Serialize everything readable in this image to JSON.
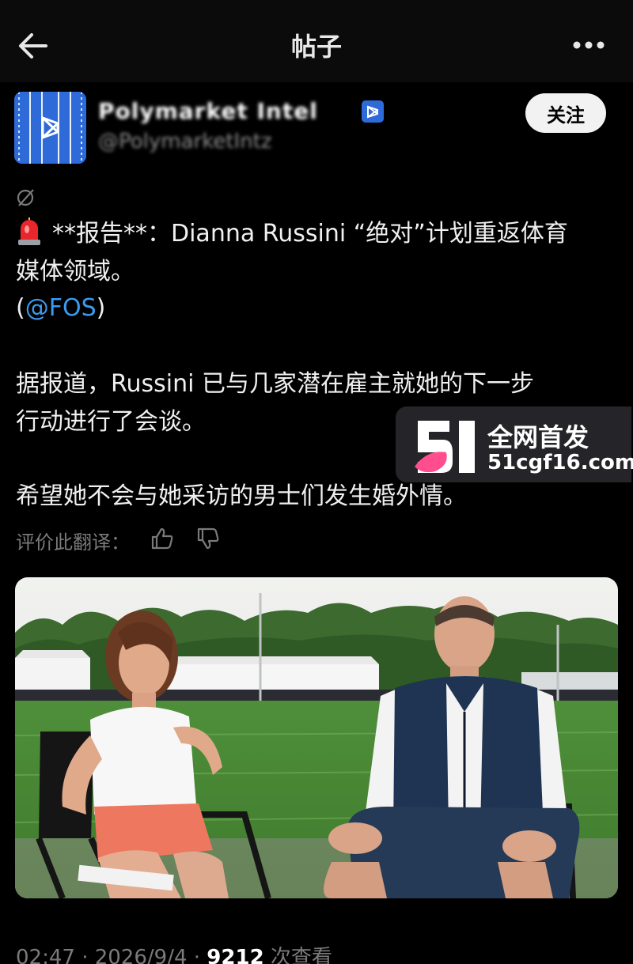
{
  "header": {
    "title": "帖子"
  },
  "author": {
    "name": "Polymarket Intel",
    "handle": "@PolymarketIntz",
    "follow_label": "关注"
  },
  "post": {
    "line1": "**报告**：Dianna Russini “绝对”计划重返体育",
    "line2": "媒体领域。",
    "mention_open": "(",
    "mention": "@FOS",
    "mention_close": ")",
    "line4": "据报道，Russini 已与几家潜在雇主就她的下一步",
    "line5": "行动进行了会谈。",
    "line6": "希望她不会与她采访的男士们发生婚外情。"
  },
  "translation": {
    "rate_label": "评价此翻译："
  },
  "watermark": {
    "title": "全网首发",
    "url": "51cgf16.com"
  },
  "footer": {
    "time": "02:47 · 2026/9/4 · ",
    "views": "9212",
    "views_suffix": " 次查看"
  },
  "icons": {
    "back": "arrow-left-icon",
    "more": "more-dots-icon",
    "verified": "verified-badge-icon",
    "translate": "translate-icon",
    "siren": "rotating-light-emoji",
    "thumb_up": "thumb-up-icon",
    "thumb_down": "thumb-down-icon"
  },
  "colors": {
    "link": "#3a9bf0",
    "avatar": "#2e6bd9",
    "follow_bg": "#f2f2f2"
  }
}
